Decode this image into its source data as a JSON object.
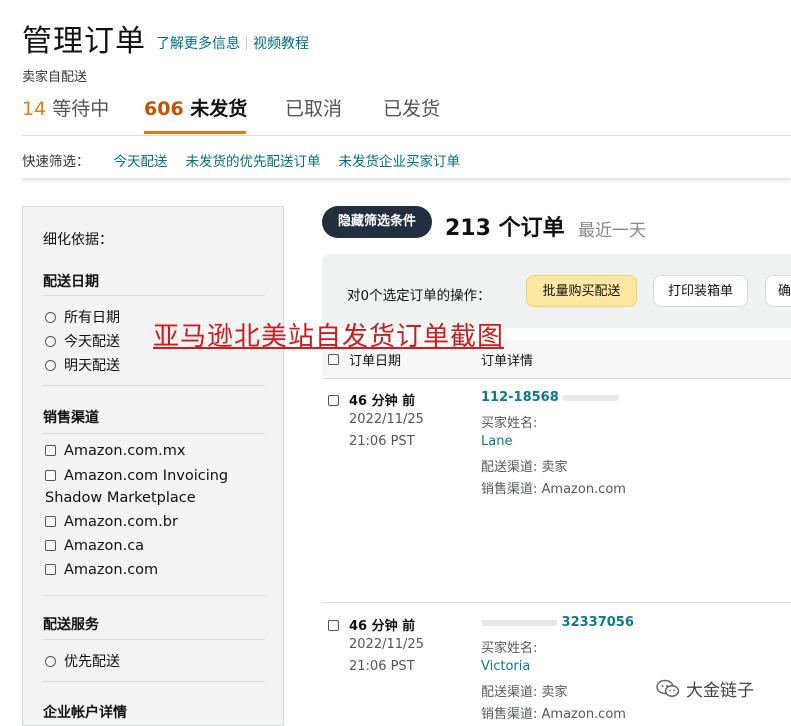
{
  "header": {
    "title": "管理订单",
    "links": [
      "了解更多信息",
      "视频教程"
    ],
    "subtitle": "卖家自配送"
  },
  "tabs": [
    {
      "count": "14",
      "label": "等待中"
    },
    {
      "count": "606",
      "label": "未发货"
    },
    {
      "count": "",
      "label": "已取消"
    },
    {
      "count": "",
      "label": "已发货"
    }
  ],
  "quick_filter": {
    "label": "快速筛选：",
    "links": [
      "今天配送",
      "未发货的优先配送订单",
      "未发货企业买家订单"
    ]
  },
  "sidebar": {
    "refine_label": "细化依据：",
    "delivery_date": {
      "heading": "配送日期",
      "options": [
        "所有日期",
        "今天配送",
        "明天配送"
      ]
    },
    "sales_channel": {
      "heading": "销售渠道",
      "options": [
        "Amazon.com.mx",
        "Amazon.com Invoicing",
        "Shadow Marketplace",
        "Amazon.com.br",
        "Amazon.ca",
        "Amazon.com"
      ]
    },
    "shipping_service": {
      "heading": "配送服务",
      "options": [
        "优先配送"
      ]
    },
    "business_heading": "企业帐户详情"
  },
  "main": {
    "hide_filters": "隐藏筛选条件",
    "order_count": "213 个订单",
    "range": "最近一天",
    "action_label": "对0个选定订单的操作：",
    "buttons": [
      "批量购买配送",
      "打印装箱单",
      "确"
    ]
  },
  "overlay_caption": "亚马逊北美站自发货订单截图",
  "table": {
    "columns": [
      "订单日期",
      "订单详情"
    ],
    "rows": [
      {
        "age": "46 分钟 前",
        "date": "2022/11/25",
        "time": "21:06 PST",
        "order_id": "112-18568",
        "buyer_label": "买家姓名:",
        "buyer": "Lane",
        "ship_channel": "配送渠道: 卖家",
        "sales_channel": "销售渠道: Amazon.com"
      },
      {
        "age": "46 分钟 前",
        "date": "2022/11/25",
        "time": "21:06 PST",
        "order_id": "32337056",
        "buyer_label": "买家姓名:",
        "buyer": "Victoria",
        "ship_channel": "配送渠道: 卖家",
        "sales_channel": "销售渠道: Amazon.com"
      }
    ]
  },
  "watermark": "大金链子"
}
